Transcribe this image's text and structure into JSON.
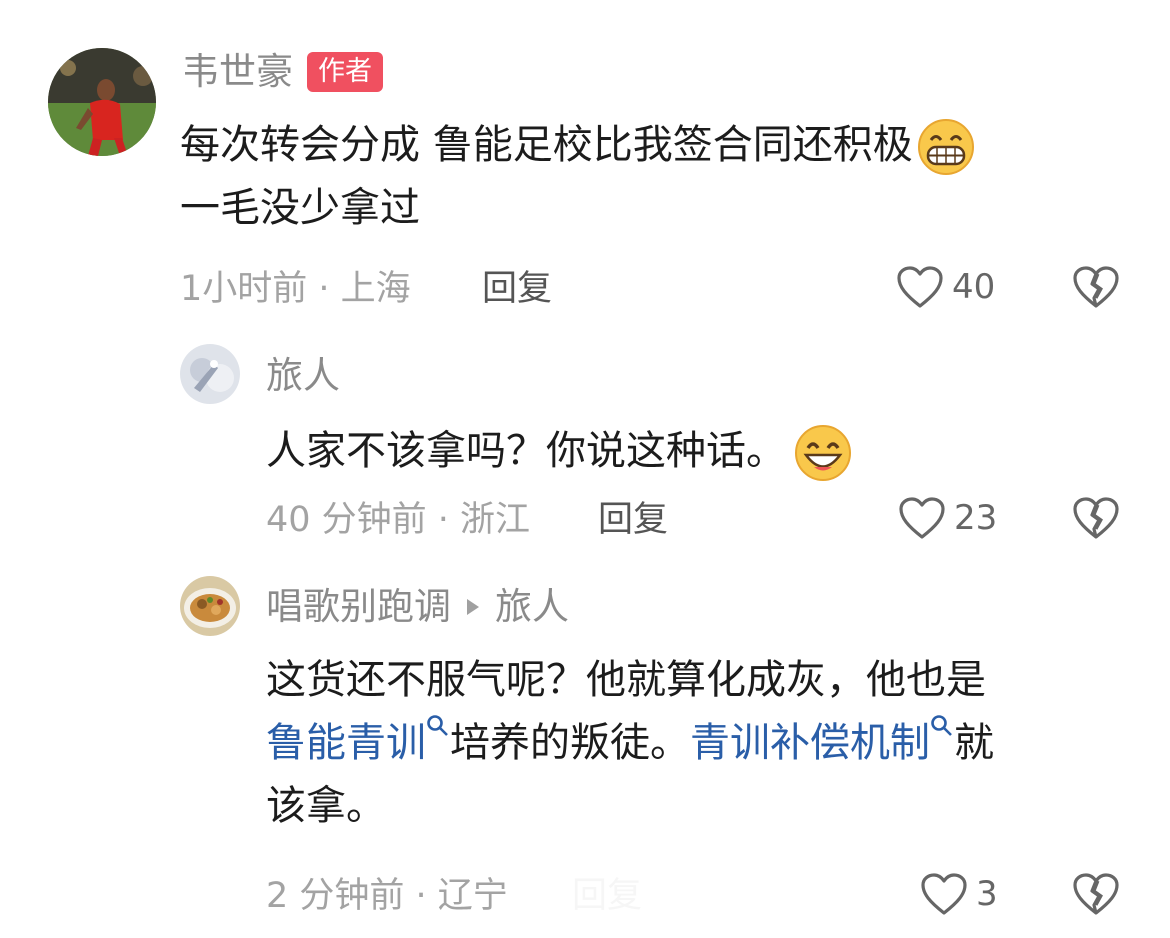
{
  "comments": [
    {
      "author": "韦世豪",
      "badge": "作者",
      "line1": "每次转会分成 鲁能足校比我签合同还积极",
      "line2": "一毛没少拿过",
      "meta": "1小时前 · 上海",
      "reply": "回复",
      "likes": "40",
      "emoji_icon": "grinning-teeth-emoji"
    },
    {
      "author": "旅人",
      "line1": "人家不该拿吗？你说这种话。",
      "meta": "40 分钟前 · 浙江",
      "reply": "回复",
      "likes": "23",
      "emoji_icon": "grinning-emoji"
    },
    {
      "author": "唱歌别跑调",
      "reply_to": "旅人",
      "line1": "这货还不服气呢？他就算化成灰，他也是",
      "link1": "鲁能青训",
      "line2_mid": "培养的叛徒。",
      "link2": "青训补偿机制",
      "line2_end": "就",
      "line3": "该拿。",
      "meta": "2 分钟前 · 辽宁",
      "reply": "回复",
      "likes": "3"
    }
  ],
  "colors": {
    "badge": "#f05060",
    "link": "#2a5ea8",
    "meta": "#a3a3a3"
  }
}
